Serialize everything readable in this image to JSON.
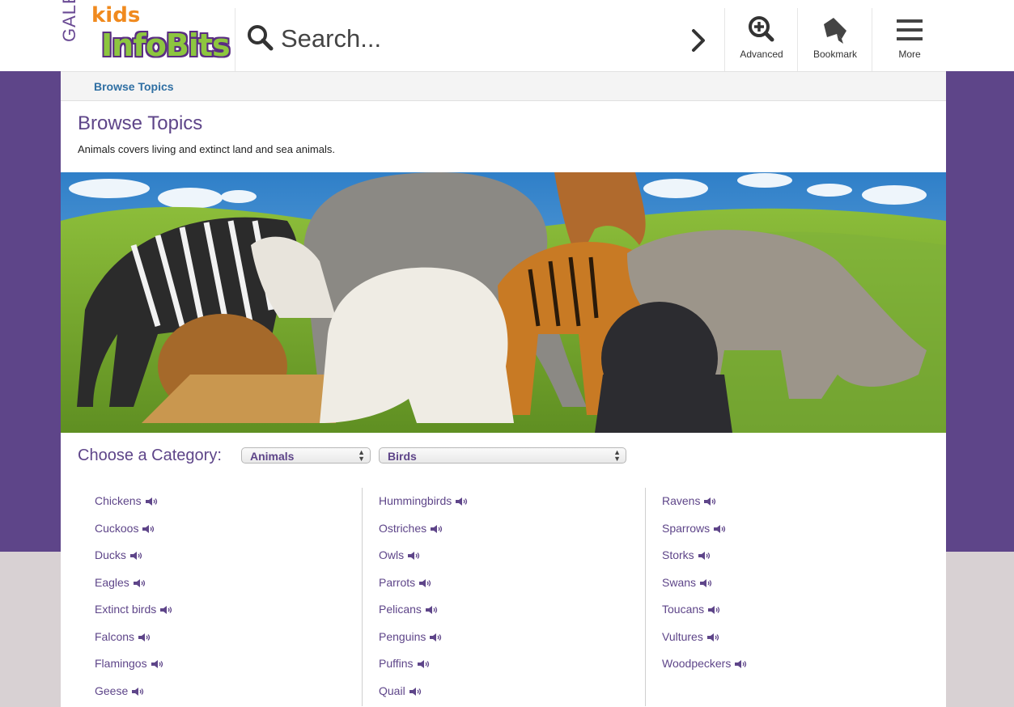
{
  "header": {
    "logo": {
      "brand": "GALE",
      "kids": "kids",
      "product": "InfoBits"
    },
    "search": {
      "placeholder": "Search..."
    },
    "tools": [
      {
        "label": "Advanced",
        "icon": "zoom-plus-icon"
      },
      {
        "label": "Bookmark",
        "icon": "bookmark-icon"
      },
      {
        "label": "More",
        "icon": "hamburger-menu-icon"
      }
    ]
  },
  "breadcrumb": {
    "label": "Browse Topics"
  },
  "page": {
    "title": "Browse Topics",
    "description": "Animals covers living and extinct land and sea animals."
  },
  "category": {
    "label": "Choose a Category:",
    "primary_selected": "Animals",
    "secondary_selected": "Birds"
  },
  "topics": {
    "col1": [
      "Chickens",
      "Cuckoos",
      "Ducks",
      "Eagles",
      "Extinct birds",
      "Falcons",
      "Flamingos",
      "Geese"
    ],
    "col2": [
      "Hummingbirds",
      "Ostriches",
      "Owls",
      "Parrots",
      "Pelicans",
      "Penguins",
      "Puffins",
      "Quail"
    ],
    "col3": [
      "Ravens",
      "Sparrows",
      "Storks",
      "Swans",
      "Toucans",
      "Vultures",
      "Woodpeckers"
    ]
  },
  "colors": {
    "brand_purple": "#5e4589",
    "link_blue": "#2f6fa3",
    "logo_green": "#8dc63f",
    "logo_orange": "#f08a1e",
    "footer_gray": "#d8d1d3"
  }
}
